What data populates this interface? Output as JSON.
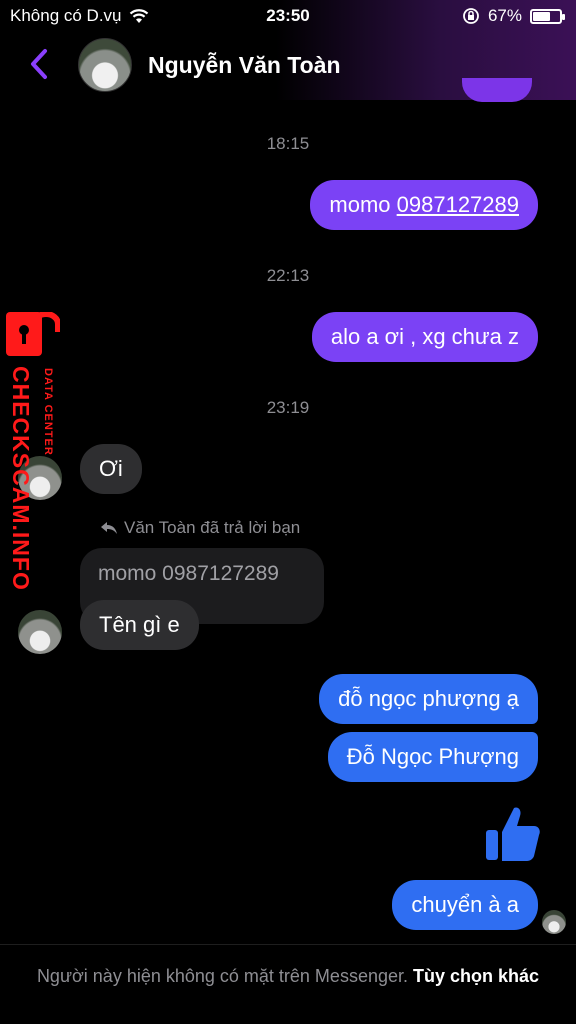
{
  "status_bar": {
    "carrier": "Không có D.vụ",
    "time": "23:50",
    "battery": "67%",
    "battery_level": 0.67
  },
  "header": {
    "contact_name": "Nguyễn Văn Toàn"
  },
  "messages": {
    "ts1": "18:15",
    "m1_prefix": "momo ",
    "m1_link": "0987127289",
    "ts2": "22:13",
    "m2": "alo a ơi , xg chưa z",
    "ts3": "23:19",
    "m3": "Ơi",
    "reply_label": "Văn Toàn đã trả lời bạn",
    "quoted": "momo 0987127289",
    "m4": "Tên gì e",
    "m5": "đỗ ngọc phượng ạ",
    "m6": "Đỗ Ngọc Phượng",
    "m7": "chuyển à a"
  },
  "watermark": {
    "main": "CHECKSCAM.INFO",
    "sub": "DATA CENTER"
  },
  "footer": {
    "notice": "Người này hiện không có mặt trên Messenger.",
    "more": "Tùy chọn khác"
  },
  "colors": {
    "sent_purple": "#7b42f5",
    "sent_blue": "#2f6ef2",
    "received_gray": "#2e2e30",
    "accent_purple": "#8a3ffc",
    "watermark_red": "#ff1a1a"
  }
}
